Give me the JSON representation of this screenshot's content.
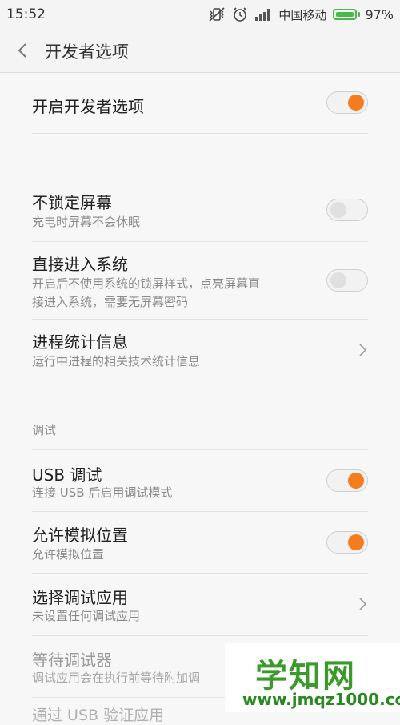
{
  "status_bar": {
    "time": "15:52",
    "carrier": "中国移动",
    "battery_percent": "97%",
    "battery_level": 0.97,
    "icons": [
      "vibrate-off-icon",
      "alarm-icon",
      "signal-icon",
      "battery-icon"
    ]
  },
  "header": {
    "title": "开发者选项",
    "back_icon": "chevron-left-icon"
  },
  "rows": {
    "dev_options": {
      "title": "开启开发者选项",
      "toggle_on": true
    },
    "stay_awake": {
      "title": "不锁定屏幕",
      "subtitle": "充电时屏幕不会休眠",
      "toggle_on": false
    },
    "direct_boot": {
      "title": "直接进入系统",
      "subtitle_line1": "开启后不使用系统的锁屏样式，点亮屏幕直",
      "subtitle_line2": "接进入系统，需要无屏幕密码",
      "toggle_on": false
    },
    "process_stats": {
      "title": "进程统计信息",
      "subtitle": "运行中进程的相关技术统计信息"
    },
    "usb_debug": {
      "title": "USB 调试",
      "subtitle": "连接 USB 后启用调试模式",
      "toggle_on": true
    },
    "mock_location": {
      "title": "允许模拟位置",
      "subtitle": "允许模拟位置",
      "toggle_on": true
    },
    "debug_app": {
      "title": "选择调试应用",
      "subtitle": "未设置任何调试应用"
    },
    "wait_debugger": {
      "title": "等待调试器",
      "subtitle": "调试应用会在执行前等待附加调"
    },
    "verify_usb": {
      "title": "通过 USB 验证应用"
    }
  },
  "groups": {
    "debug_label": "调试"
  },
  "colors": {
    "accent": "#f57c1f",
    "background": "#f7f7f7",
    "battery": "#49b84a"
  },
  "watermark": {
    "main": "学知网",
    "url": "www.jmqz1000.com"
  }
}
